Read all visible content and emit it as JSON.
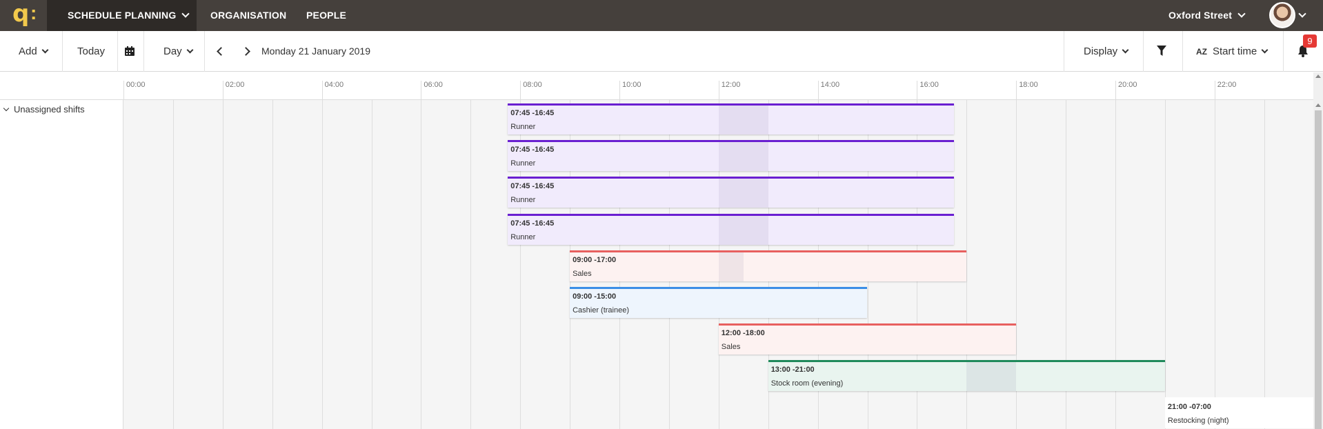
{
  "app": {
    "nav": {
      "schedule_planning": "SCHEDULE PLANNING",
      "organisation": "ORGANISATION",
      "people": "PEOPLE"
    },
    "location": "Oxford Street"
  },
  "toolbar": {
    "add": "Add",
    "today": "Today",
    "view": "Day",
    "date": "Monday 21 January 2019",
    "display": "Display",
    "sort_icon_text": "AZ",
    "sort": "Start time",
    "notifications": "9"
  },
  "timeline": {
    "ticks": [
      "00:00",
      "02:00",
      "04:00",
      "06:00",
      "08:00",
      "10:00",
      "12:00",
      "14:00",
      "16:00",
      "18:00",
      "20:00",
      "22:00"
    ]
  },
  "group": {
    "label": "Unassigned shifts"
  },
  "colors": {
    "runner": "#6a1fd1",
    "sales": "#e8605f",
    "cashier": "#3a8ee6",
    "stock": "#1f8a5b",
    "restocking": "#cccccc"
  },
  "shifts": [
    {
      "time": "07:45 -16:45",
      "role": "Runner",
      "start": "07:45",
      "end": "16:45",
      "color_key": "runner"
    },
    {
      "time": "07:45 -16:45",
      "role": "Runner",
      "start": "07:45",
      "end": "16:45",
      "color_key": "runner"
    },
    {
      "time": "07:45 -16:45",
      "role": "Runner",
      "start": "07:45",
      "end": "16:45",
      "color_key": "runner"
    },
    {
      "time": "07:45 -16:45",
      "role": "Runner",
      "start": "07:45",
      "end": "16:45",
      "color_key": "runner"
    },
    {
      "time": "09:00 -17:00",
      "role": "Sales",
      "start": "09:00",
      "end": "17:00",
      "color_key": "sales"
    },
    {
      "time": "09:00 -15:00",
      "role": "Cashier (trainee)",
      "start": "09:00",
      "end": "15:00",
      "color_key": "cashier"
    },
    {
      "time": "12:00 -18:00",
      "role": "Sales",
      "start": "12:00",
      "end": "18:00",
      "color_key": "sales"
    },
    {
      "time": "13:00 -21:00",
      "role": "Stock room (evening)",
      "start": "13:00",
      "end": "21:00",
      "color_key": "stock"
    },
    {
      "time": "21:00 -07:00",
      "role": "Restocking (night)",
      "start": "21:00",
      "end": "07:00",
      "color_key": "restocking"
    }
  ]
}
